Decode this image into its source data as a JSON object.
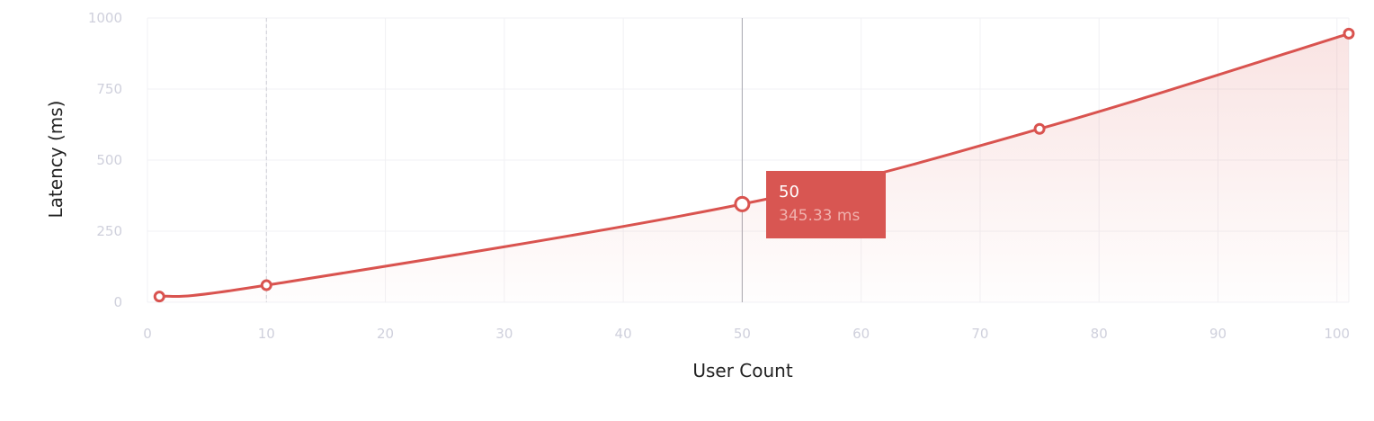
{
  "chart_data": {
    "type": "area",
    "title": "",
    "xlabel": "User Count",
    "ylabel": "Latency (ms)",
    "xlim": [
      0,
      101
    ],
    "ylim": [
      0,
      1000
    ],
    "x_ticks": [
      0,
      10,
      20,
      30,
      40,
      50,
      60,
      70,
      80,
      90,
      100
    ],
    "y_ticks": [
      0,
      250,
      500,
      750,
      1000
    ],
    "x_tick_labels": [
      "0",
      "10",
      "20",
      "30",
      "40",
      "50",
      "60",
      "70",
      "80",
      "90",
      "100"
    ],
    "y_tick_labels": [
      "0",
      "250",
      "500",
      "750",
      "1000"
    ],
    "grid": true,
    "series": [
      {
        "x": [
          1,
          10,
          50,
          75,
          101
        ],
        "y": [
          20,
          60,
          345.33,
          610,
          945
        ],
        "color": "#d9534f"
      }
    ],
    "highlight": {
      "x": 50,
      "y": 345.33,
      "x_label": "50",
      "y_label": "345.33 ms"
    },
    "reference_line_x": 10
  }
}
